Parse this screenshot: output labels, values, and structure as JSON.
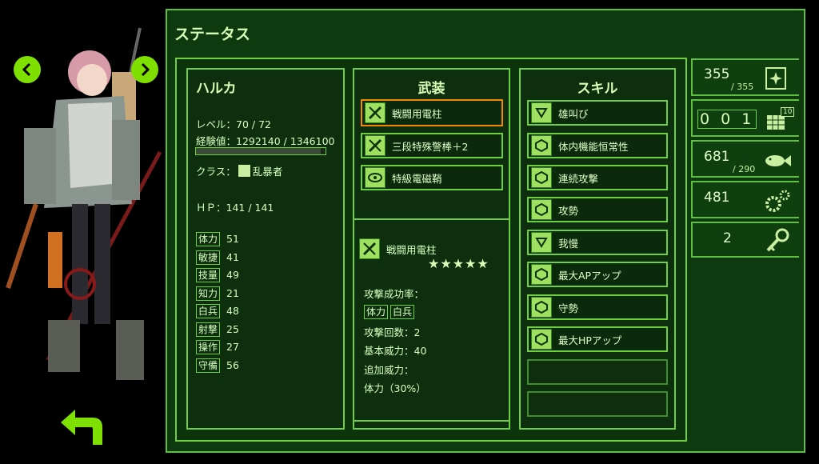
{
  "screen_title": "ステータス",
  "character": {
    "name": "ハルカ",
    "level": "レベル：70 / 72",
    "exp": "経験値：1292140 / 1346100",
    "exp_fraction": 0.96,
    "class_label": "クラス：",
    "class_value": "乱暴者",
    "hp": "ＨＰ：141 / 141",
    "stats": [
      {
        "label": "体力",
        "value": "51"
      },
      {
        "label": "敏捷",
        "value": "41"
      },
      {
        "label": "技量",
        "value": "49"
      },
      {
        "label": "知力",
        "value": "21"
      },
      {
        "label": "白兵",
        "value": "48"
      },
      {
        "label": "射撃",
        "value": "25"
      },
      {
        "label": "操作",
        "value": "27"
      },
      {
        "label": "守備",
        "value": "56"
      }
    ]
  },
  "weapons": {
    "header": "武装",
    "items": [
      "戦闘用電柱",
      "三段特殊警棒＋2",
      "特級電磁鞘"
    ],
    "selected_index": 0,
    "detail": {
      "name": "戦闘用電柱",
      "stars": "★★★★★",
      "success_rate_label": "攻撃成功率：",
      "success_stats": [
        "体力",
        "白兵"
      ],
      "attack_count": "攻撃回数：2",
      "base_power": "基本威力：40",
      "extra_power_label": "追加威力：",
      "extra_power": "体力（30%）"
    }
  },
  "skills": {
    "header": "スキル",
    "items": [
      "雄叫び",
      "体内機能恒常性",
      "連続攻撃",
      "攻勢",
      "我慢",
      "最大APアップ",
      "守勢",
      "最大HPアップ",
      "",
      ""
    ]
  },
  "side_panel": [
    {
      "value": "355",
      "max": "/ 355",
      "icon": "sparkle-card-icon"
    },
    {
      "value": "0 0 1",
      "badge": "10",
      "icon": "calendar-icon"
    },
    {
      "value": "681",
      "max": "/ 290",
      "icon": "fish-icon"
    },
    {
      "value": "481",
      "icon": "gears-icon"
    },
    {
      "value": "2",
      "icon": "key-icon"
    }
  ],
  "colors": {
    "accent": "#7fe000",
    "panel": "#0f3a0f",
    "border": "#6fcf40",
    "selected": "#f08a00"
  }
}
